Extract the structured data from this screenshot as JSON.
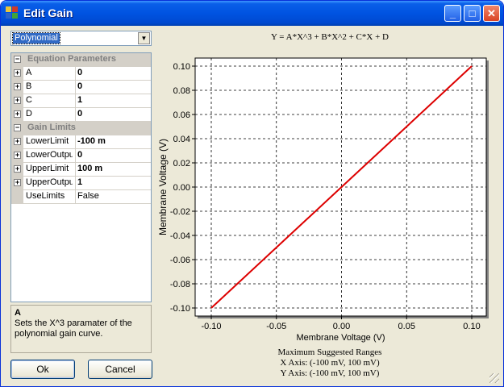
{
  "window": {
    "title": "Edit Gain",
    "controls": {
      "minimize": "_",
      "maximize": "□",
      "close": "✕"
    }
  },
  "combo": {
    "selected": "Polynomial",
    "arrow_icon": "▼"
  },
  "property_grid": {
    "categories": [
      {
        "label": "Equation Parameters",
        "rows": [
          {
            "name": "A",
            "value": "0",
            "expandable": true,
            "bold": true
          },
          {
            "name": "B",
            "value": "0",
            "expandable": true,
            "bold": true
          },
          {
            "name": "C",
            "value": "1",
            "expandable": true,
            "bold": true
          },
          {
            "name": "D",
            "value": "0",
            "expandable": true,
            "bold": true
          }
        ]
      },
      {
        "label": "Gain Limits",
        "rows": [
          {
            "name": "LowerLimit",
            "value": "-100 m",
            "expandable": true,
            "bold": true
          },
          {
            "name": "LowerOutpu",
            "value": "0",
            "expandable": true,
            "bold": true
          },
          {
            "name": "UpperLimit",
            "value": "100 m",
            "expandable": true,
            "bold": true
          },
          {
            "name": "UpperOutpu",
            "value": "1",
            "expandable": true,
            "bold": true
          },
          {
            "name": "UseLimits",
            "value": "False",
            "expandable": false,
            "bold": false
          }
        ]
      }
    ]
  },
  "help": {
    "title": "A",
    "description": "Sets the X^3 paramater of the polynomial gain curve."
  },
  "buttons": {
    "ok": "Ok",
    "cancel": "Cancel"
  },
  "chart_title": "Y = A*X^3 + B*X^2 + C*X + D",
  "ranges": {
    "heading": "Maximum Suggested Ranges",
    "x": "X Axis: (-100 mV, 100 mV)",
    "y": "Y Axis: (-100 mV, 100 mV)"
  },
  "chart_data": {
    "type": "line",
    "title": "Y = A*X^3 + B*X^2 + C*X + D",
    "xlabel": "Membrane Voltage (V)",
    "ylabel": "Membrane Voltage (V)",
    "xlim": [
      -0.1,
      0.1
    ],
    "ylim": [
      -0.1,
      0.1
    ],
    "x_ticks": [
      -0.1,
      -0.05,
      0,
      0.05,
      0.1
    ],
    "x_tick_labels": [
      "-0.10",
      "-0.05",
      "0.00",
      "0.05",
      "0.10"
    ],
    "y_ticks": [
      -0.1,
      -0.08,
      -0.06,
      -0.04,
      -0.02,
      0,
      0.02,
      0.04,
      0.06,
      0.08,
      0.1
    ],
    "y_tick_labels": [
      "-0.10",
      "-0.08",
      "-0.06",
      "-0.04",
      "-0.02",
      "0.00",
      "0.02",
      "0.04",
      "0.06",
      "0.08",
      "0.10"
    ],
    "grid": true,
    "series": [
      {
        "color": "#dd0000",
        "x": [
          -0.1,
          0,
          0.1
        ],
        "y": [
          -0.1,
          0,
          0.1
        ]
      }
    ]
  }
}
